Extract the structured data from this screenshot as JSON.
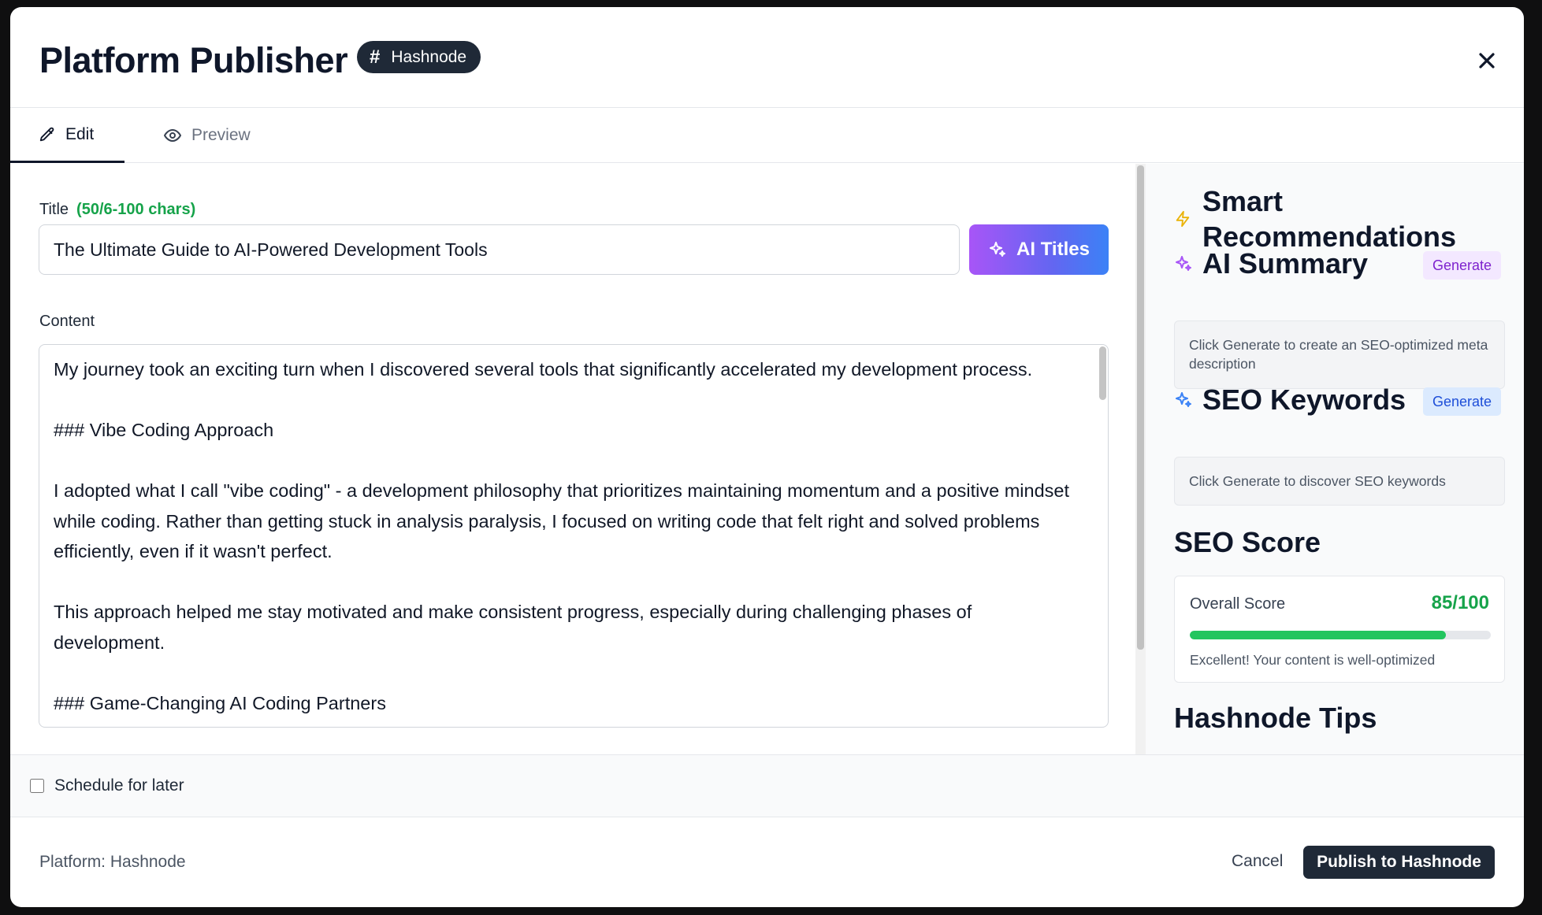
{
  "header": {
    "title": "Platform Publisher",
    "platform_badge": "Hashnode",
    "badge_icon": "hash-icon"
  },
  "tabs": [
    {
      "label": "Edit",
      "icon": "pencil-icon",
      "active": true
    },
    {
      "label": "Preview",
      "icon": "eye-icon",
      "active": false
    }
  ],
  "editor": {
    "title_label": "Title",
    "title_count": "(50/6-100 chars)",
    "title_value": "The Ultimate Guide to AI-Powered Development Tools",
    "ai_titles_label": "AI Titles",
    "content_label": "Content",
    "content_value": "My journey took an exciting turn when I discovered several tools that significantly accelerated my development process.\n\n### Vibe Coding Approach\n\nI adopted what I call \"vibe coding\" - a development philosophy that prioritizes maintaining momentum and a positive mindset while coding. Rather than getting stuck in analysis paralysis, I focused on writing code that felt right and solved problems efficiently, even if it wasn't perfect.\n\nThis approach helped me stay motivated and make consistent progress, especially during challenging phases of development.\n\n### Game-Changing AI Coding Partners"
  },
  "sidebar": {
    "recommendations_title": "Smart Recommendations",
    "ai_summary": {
      "title": "AI Summary",
      "button": "Generate",
      "placeholder": "Click Generate to create an SEO-optimized meta description"
    },
    "seo_keywords": {
      "title": "SEO Keywords",
      "button": "Generate",
      "placeholder": "Click Generate to discover SEO keywords"
    },
    "seo_score": {
      "title": "SEO Score",
      "label": "Overall Score",
      "value": "85/100",
      "fraction": 0.85,
      "note": "Excellent! Your content is well-optimized"
    },
    "tips_title": "Hashnode Tips"
  },
  "schedule": {
    "label": "Schedule for later",
    "checked": false
  },
  "footer": {
    "platform_text": "Platform: Hashnode",
    "cancel_label": "Cancel",
    "publish_label": "Publish to Hashnode"
  },
  "colors": {
    "accent_green": "#16a34a",
    "bar_green": "#22c55e",
    "dark": "#1f2937",
    "purple": "#a855f7",
    "blue": "#3b82f6",
    "bolt_yellow": "#eab308"
  }
}
